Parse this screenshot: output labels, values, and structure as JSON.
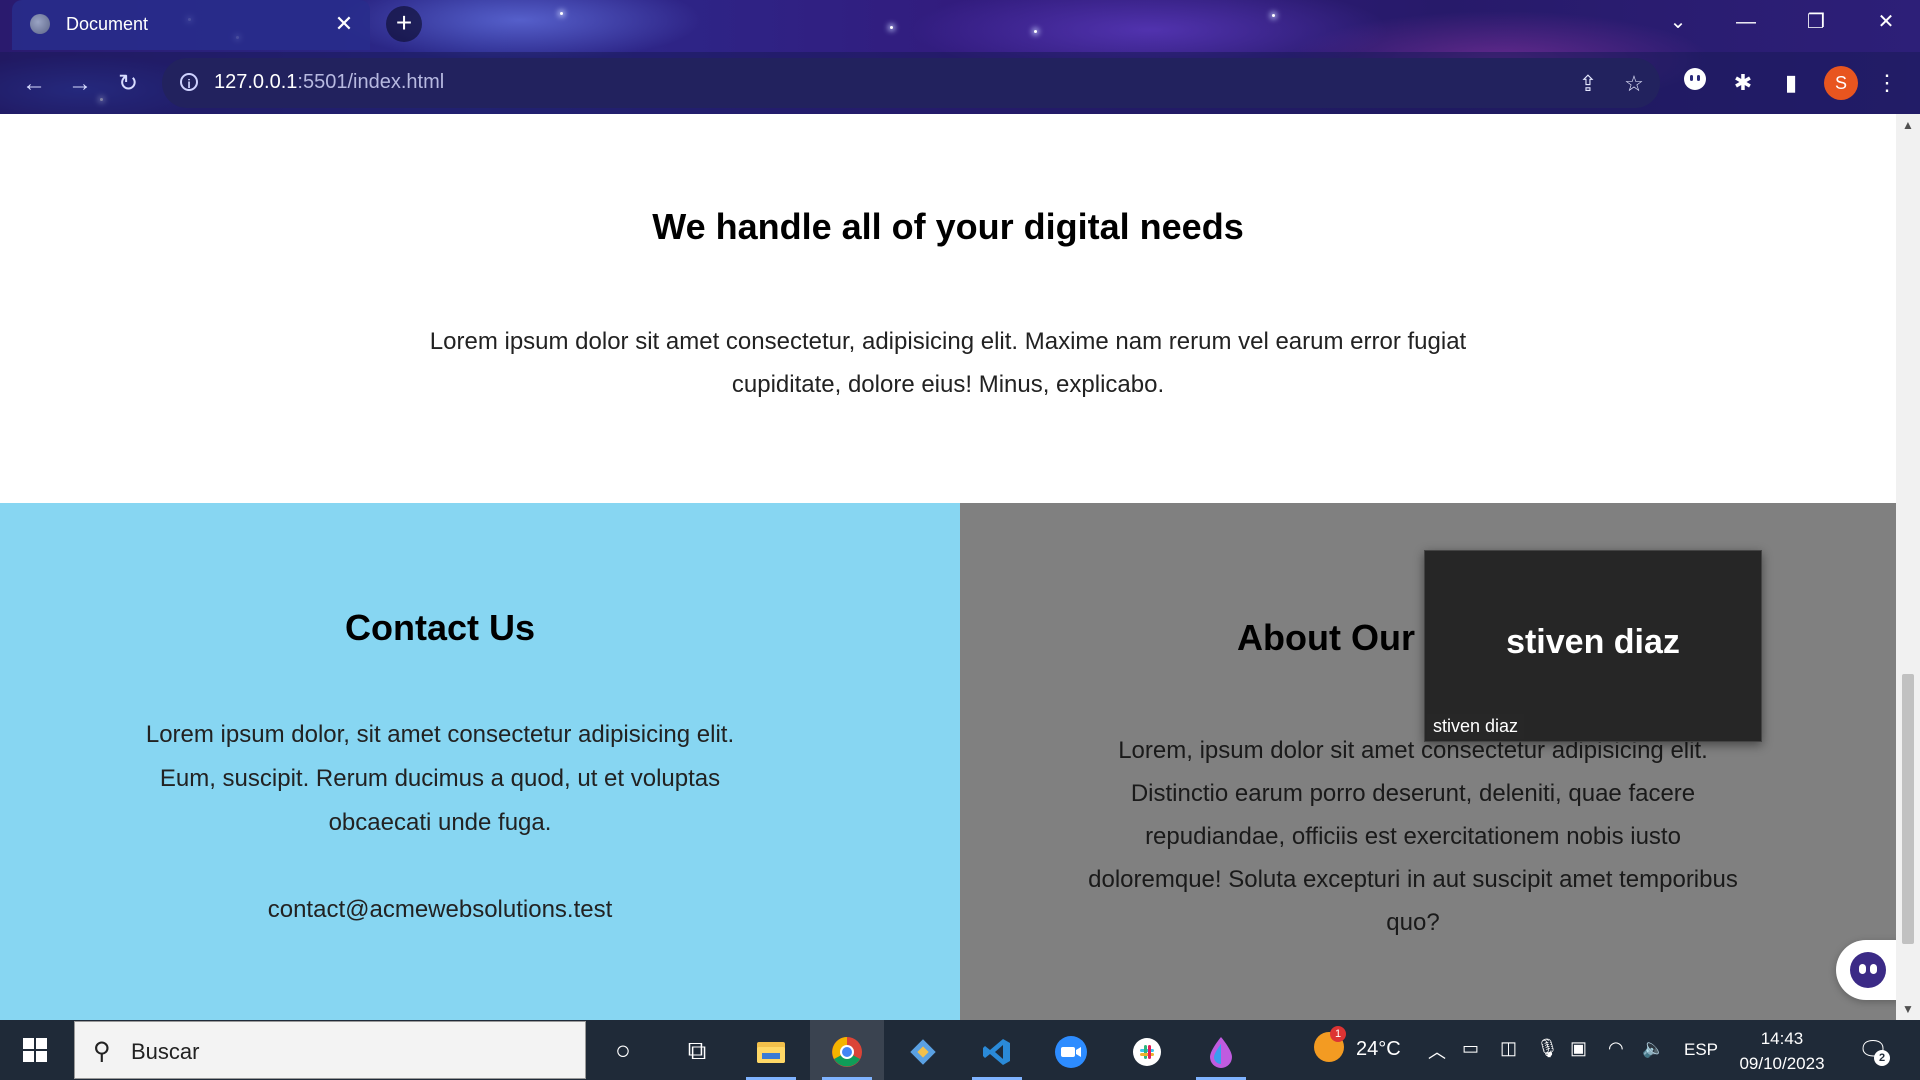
{
  "browser": {
    "tab_title": "Document",
    "tab_close": "✕",
    "new_tab": "+",
    "url_host": "127.0.0.1",
    "url_path": ":5501/index.html",
    "profile_initial": "S",
    "window_controls": {
      "tabsearch": "⌄",
      "minimize": "—",
      "restore": "❐",
      "close": "✕"
    },
    "nav": {
      "back": "←",
      "forward": "→",
      "reload": "↻"
    },
    "icons": {
      "share": "⇪",
      "bookmark": "☆",
      "extensions": "✱",
      "sidepanel": "▮",
      "menu": "⋮"
    }
  },
  "page": {
    "hero": {
      "title": "We handle all of your digital needs",
      "text": "Lorem ipsum dolor sit amet consectetur, adipisicing elit. Maxime nam rerum vel earum error fugiat cupiditate, dolore eius! Minus, explicabo."
    },
    "contact": {
      "title": "Contact Us",
      "text": "Lorem ipsum dolor, sit amet consectetur adipisicing elit. Eum, suscipit. Rerum ducimus a quod, ut et voluptas obcaecati unde fuga.",
      "email": "contact@acmewebsolutions.test",
      "bg_color": "#87d6f2"
    },
    "about": {
      "title": "About Our Company",
      "text": "Lorem, ipsum dolor sit amet consectetur adipisicing elit. Distinctio earum porro deserunt, deleniti, quae facere repudiandae, officiis est exercitationem nobis iusto doloremque! Soluta excepturi in aut suscipit amet temporibus quo?",
      "bg_color": "#808080"
    }
  },
  "video_overlay": {
    "name": "stiven diaz",
    "caption": "stiven diaz"
  },
  "taskbar": {
    "search_placeholder": "Buscar",
    "weather_temp": "24°C",
    "weather_badge": "1",
    "language": "ESP",
    "time": "14:43",
    "date": "09/10/2023",
    "notifications_count": "2",
    "apps": [
      "cortana-icon",
      "task-view-icon",
      "file-explorer-icon",
      "chrome-icon",
      "git-icon",
      "vscode-icon",
      "zoom-icon",
      "slack-icon",
      "paint-icon"
    ]
  }
}
